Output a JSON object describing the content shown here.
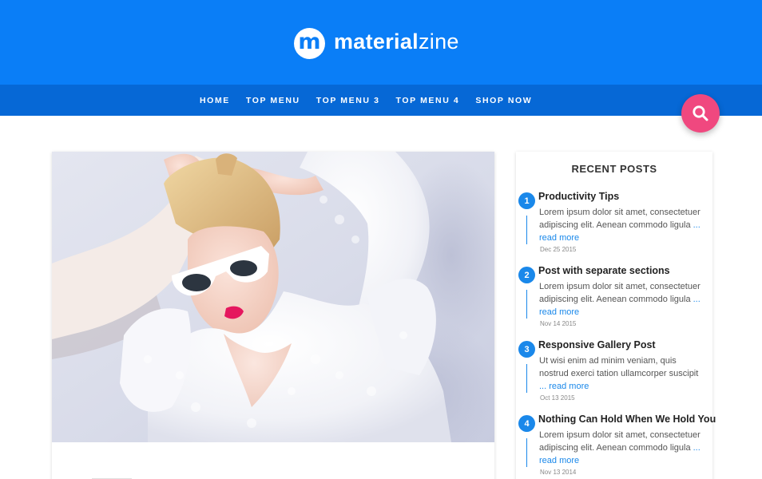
{
  "logo": {
    "mark": "m",
    "bold": "material",
    "light": "zine"
  },
  "nav": {
    "items": [
      "HOME",
      "TOP MENU",
      "TOP MENU 3",
      "TOP MENU 4",
      "SHOP NOW"
    ]
  },
  "colors": {
    "header": "#0a7ef7",
    "nav": "#0668d6",
    "accent": "#1a88ea",
    "search": "#f0487f"
  },
  "search": {
    "icon": "search-icon"
  },
  "sidebar": {
    "title": "RECENT POSTS",
    "posts": [
      {
        "number": "1",
        "title": "Productivity Tips",
        "excerpt": "Lorem ipsum dolor sit amet, consectetuer adipiscing elit. Aenean commodo ligula",
        "read_more": "... read more",
        "date": "Dec 25 2015"
      },
      {
        "number": "2",
        "title": "Post with separate sections",
        "excerpt": "Lorem ipsum dolor sit amet, consectetuer adipiscing elit. Aenean commodo ligula",
        "read_more": "... read more",
        "date": "Nov 14 2015"
      },
      {
        "number": "3",
        "title": "Responsive Gallery Post",
        "excerpt": "Ut wisi enim ad minim veniam, quis nostrud exerci tation ullamcorper suscipit",
        "read_more": "... read more",
        "date": "Oct 13 2015"
      },
      {
        "number": "4",
        "title": "Nothing Can Hold When We Hold You",
        "excerpt": "Lorem ipsum dolor sit amet, consectetuer adipiscing elit. Aenean commodo ligula",
        "read_more": "... read more",
        "date": "Nov 13 2014"
      }
    ]
  }
}
